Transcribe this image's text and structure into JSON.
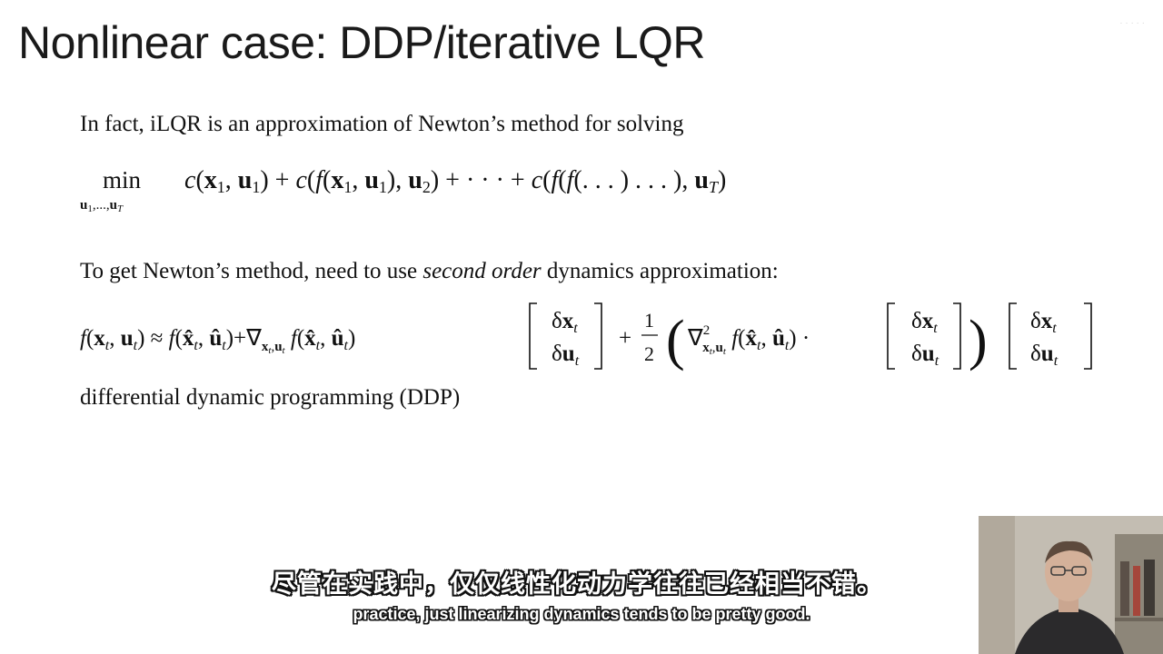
{
  "slide": {
    "title": "Nonlinear case: DDP/iterative LQR",
    "line1": "In fact, iLQR is an approximation of Newton’s method for solving",
    "line2_pre": "To get Newton’s method, need to use ",
    "line2_em": "second order",
    "line2_post": " dynamics approximation:",
    "line3": "differential dynamic programming (DDP)"
  },
  "subtitles": {
    "chinese": "尽管在实践中，仅仅线性化动力学往往已经相当不错。",
    "english": "practice, just linearizing dynamics tends to be pretty good."
  }
}
